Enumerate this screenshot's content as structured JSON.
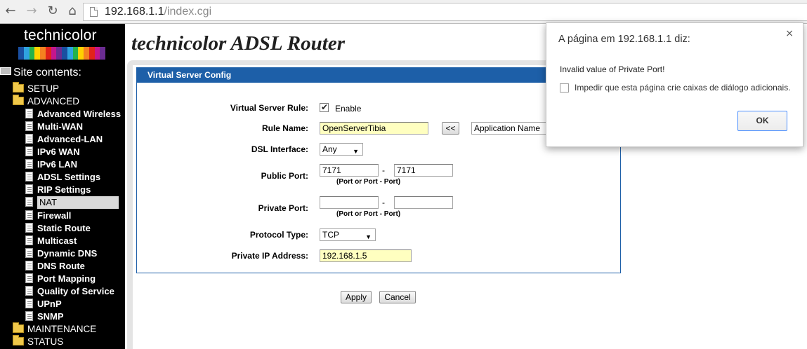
{
  "browser": {
    "url_host": "192.168.1.1",
    "url_path": "/index.cgi"
  },
  "sidebar": {
    "logo_text": "technicolor",
    "logo_colors": [
      "#1a4fa0",
      "#2fa3e0",
      "#23b24b",
      "#ffd200",
      "#f58220",
      "#e2231a",
      "#c5168c",
      "#6b2c91",
      "#1a4fa0",
      "#2fa3e0",
      "#23b24b",
      "#ffd200",
      "#f58220",
      "#e2231a",
      "#c5168c",
      "#6b2c91"
    ],
    "site_contents": "Site contents:",
    "items": [
      {
        "label": "SETUP",
        "type": "folder"
      },
      {
        "label": "ADVANCED",
        "type": "folder"
      },
      {
        "label": "Advanced Wireless",
        "type": "page"
      },
      {
        "label": "Multi-WAN",
        "type": "page"
      },
      {
        "label": "Advanced-LAN",
        "type": "page"
      },
      {
        "label": "IPv6 WAN",
        "type": "page"
      },
      {
        "label": "IPv6 LAN",
        "type": "page"
      },
      {
        "label": "ADSL Settings",
        "type": "page"
      },
      {
        "label": "RIP Settings",
        "type": "page"
      },
      {
        "label": "NAT",
        "type": "page",
        "selected": true
      },
      {
        "label": "Firewall",
        "type": "page"
      },
      {
        "label": "Static Route",
        "type": "page"
      },
      {
        "label": "Multicast",
        "type": "page"
      },
      {
        "label": "Dynamic DNS",
        "type": "page"
      },
      {
        "label": "DNS Route",
        "type": "page"
      },
      {
        "label": "Port Mapping",
        "type": "page"
      },
      {
        "label": "Quality of Service",
        "type": "page"
      },
      {
        "label": "UPnP",
        "type": "page"
      },
      {
        "label": "SNMP",
        "type": "page"
      },
      {
        "label": "MAINTENANCE",
        "type": "folder"
      },
      {
        "label": "STATUS",
        "type": "folder"
      }
    ]
  },
  "header": {
    "title": "technicolor ADSL Router"
  },
  "form": {
    "section_title": "Virtual Server Config",
    "rule_label": "Virtual Server Rule:",
    "enable_label": "Enable",
    "enable_checked": true,
    "rule_name_label": "Rule Name:",
    "rule_name_value": "OpenServerTibia",
    "copy_button": "<<",
    "app_name_select": "Application Name",
    "dsl_label": "DSL Interface:",
    "dsl_value": "Any",
    "public_port_label": "Public Port:",
    "public_port_start": "7171",
    "public_port_end": "7171",
    "port_dash": "-",
    "port_hint": "(Port or Port - Port)",
    "private_port_label": "Private Port:",
    "private_port_start": "",
    "private_port_end": "",
    "protocol_label": "Protocol Type:",
    "protocol_value": "TCP",
    "private_ip_label": "Private IP Address:",
    "private_ip_value": "192.168.1.5",
    "apply_button": "Apply",
    "cancel_button": "Cancel"
  },
  "dialog": {
    "title": "A página em 192.168.1.1 diz:",
    "message": "Invalid value of Private Port!",
    "checkbox_label": "Impedir que esta página crie caixas de diálogo adicionais.",
    "ok_button": "OK"
  }
}
